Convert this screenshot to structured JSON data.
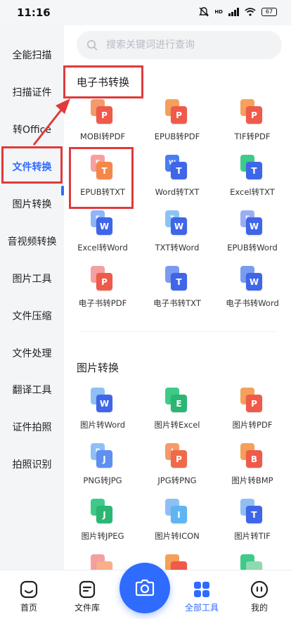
{
  "status_bar": {
    "time": "11:16",
    "hd": "HD",
    "battery": "67"
  },
  "sidebar": {
    "items": [
      {
        "label": "全能扫描"
      },
      {
        "label": "扫描证件"
      },
      {
        "label": "转Office"
      },
      {
        "label": "文件转换",
        "active": true
      },
      {
        "label": "图片转换"
      },
      {
        "label": "音视频转换"
      },
      {
        "label": "图片工具"
      },
      {
        "label": "文件压缩"
      },
      {
        "label": "文件处理"
      },
      {
        "label": "翻译工具"
      },
      {
        "label": "证件拍照"
      },
      {
        "label": "拍照识别"
      }
    ]
  },
  "search": {
    "placeholder": "搜索关键词进行查询"
  },
  "sections": [
    {
      "title": "电子书转换",
      "tools": [
        {
          "label": "MOBI转PDF",
          "back": "",
          "front": "P",
          "back_color": "#f59a6a",
          "front_color": "#ef5a4a"
        },
        {
          "label": "EPUB转PDF",
          "back": "",
          "front": "P",
          "back_color": "#f5a05a",
          "front_color": "#ef5a4a"
        },
        {
          "label": "TIF转PDF",
          "back": "",
          "front": "P",
          "back_color": "#f7a05c",
          "front_color": "#ef5a4a"
        },
        {
          "label": "EPUB转TXT",
          "back": "E",
          "front": "T",
          "back_color": "#f7a0a0",
          "front_color": "#f5874a"
        },
        {
          "label": "Word转TXT",
          "back": "W",
          "front": "T",
          "back_color": "#4a7df0",
          "front_color": "#3f66e8"
        },
        {
          "label": "Excel转TXT",
          "back": "",
          "front": "T",
          "back_color": "#3ecb8a",
          "front_color": "#3f66e8"
        },
        {
          "label": "Excel转Word",
          "back": "E",
          "front": "W",
          "back_color": "#8fb4f7",
          "front_color": "#3f66e8"
        },
        {
          "label": "TXT转Word",
          "back": "T",
          "front": "W",
          "back_color": "#8ac4f5",
          "front_color": "#3f66e8"
        },
        {
          "label": "EPUB转Word",
          "back": "E",
          "front": "W",
          "back_color": "#9aaef3",
          "front_color": "#3f66e8"
        },
        {
          "label": "电子书转PDF",
          "back": "",
          "front": "P",
          "back_color": "#f5a0a0",
          "front_color": "#ef5a4a"
        },
        {
          "label": "电子书转TXT",
          "back": "",
          "front": "T",
          "back_color": "#7a9cf0",
          "front_color": "#3f66e8"
        },
        {
          "label": "电子书转Word",
          "back": "",
          "front": "W",
          "back_color": "#7a9cf0",
          "front_color": "#3f66e8"
        }
      ]
    },
    {
      "title": "图片转换",
      "tools": [
        {
          "label": "图片转Word",
          "back": "",
          "front": "W",
          "back_color": "#8ec0f6",
          "front_color": "#3f66e8"
        },
        {
          "label": "图片转Excel",
          "back": "",
          "front": "E",
          "back_color": "#3ecb8a",
          "front_color": "#2bb673"
        },
        {
          "label": "图片转PDF",
          "back": "",
          "front": "P",
          "back_color": "#f5a05a",
          "front_color": "#ef5a4a"
        },
        {
          "label": "PNG转JPG",
          "back": "P",
          "front": "J",
          "back_color": "#8ec0f6",
          "front_color": "#5f8ff2"
        },
        {
          "label": "JPG转PNG",
          "back": "J",
          "front": "P",
          "back_color": "#f79a6a",
          "front_color": "#ef6a4a"
        },
        {
          "label": "图片转BMP",
          "back": "",
          "front": "B",
          "back_color": "#f5a05a",
          "front_color": "#ef5a4a"
        },
        {
          "label": "图片转JPEG",
          "back": "",
          "front": "J",
          "back_color": "#3ecb8a",
          "front_color": "#2bb673"
        },
        {
          "label": "图片转ICON",
          "back": "",
          "front": "I",
          "back_color": "#8ec0f6",
          "front_color": "#5fb5f2"
        },
        {
          "label": "图片转TIF",
          "back": "",
          "front": "T",
          "back_color": "#8ec0f6",
          "front_color": "#3f66e8"
        },
        {
          "label": "",
          "back": "",
          "front": "",
          "back_color": "#f5a0a0",
          "front_color": "#f7b08a"
        },
        {
          "label": "",
          "back": "",
          "front": "",
          "back_color": "#f5a05a",
          "front_color": "#ef5a4a"
        },
        {
          "label": "",
          "back": "",
          "front": "",
          "back_color": "#3ecb8a",
          "front_color": "#8fd9b0"
        }
      ]
    }
  ],
  "bottom_nav": {
    "items": [
      {
        "label": "首页"
      },
      {
        "label": "文件库"
      },
      {
        "label": "全部工具",
        "active": true
      },
      {
        "label": "我的"
      }
    ]
  },
  "colors": {
    "accent": "#2f6bff",
    "highlight": "#e03a3a"
  }
}
